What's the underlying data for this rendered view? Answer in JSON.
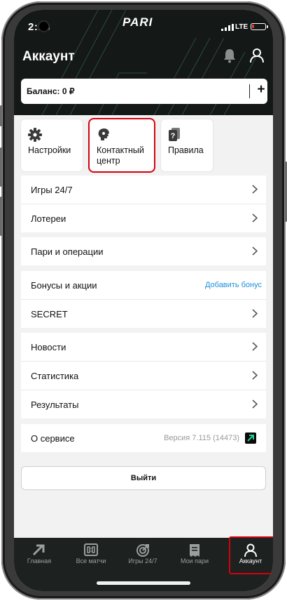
{
  "status": {
    "time": "2:13",
    "network": "LTE"
  },
  "brand": {
    "logo": "PARI",
    "accent": "#0cb36b",
    "highlight": "#d6000f"
  },
  "header": {
    "title": "Аккаунт",
    "icons": [
      "bell-icon",
      "user-icon"
    ]
  },
  "balance": {
    "label": "Баланс: 0 ₽",
    "add": "+"
  },
  "tiles": [
    {
      "label": "Настройки",
      "icon": "gear-icon"
    },
    {
      "label": "Контактный центр",
      "icon": "support-icon"
    },
    {
      "label": "Правила",
      "icon": "rules-icon"
    }
  ],
  "menu": {
    "games": "Игры 24/7",
    "lotteries": "Лотереи",
    "bets": "Пари и операции",
    "bonuses": "Бонусы и акции",
    "add_bonus": "Добавить бонус",
    "secret": "SECRET",
    "news": "Новости",
    "stats": "Статистика",
    "results": "Результаты",
    "about": "О сервисе",
    "version": "Версия 7.115 (14473)"
  },
  "logout": "Выйти",
  "tabbar": [
    {
      "label": "Главная",
      "icon": "home-arrow-icon"
    },
    {
      "label": "Все матчи",
      "icon": "scoreboard-icon"
    },
    {
      "label": "Игры 24/7",
      "icon": "target-icon"
    },
    {
      "label": "Мои пари",
      "icon": "receipt-icon"
    },
    {
      "label": "Аккаунт",
      "icon": "user-icon"
    }
  ]
}
